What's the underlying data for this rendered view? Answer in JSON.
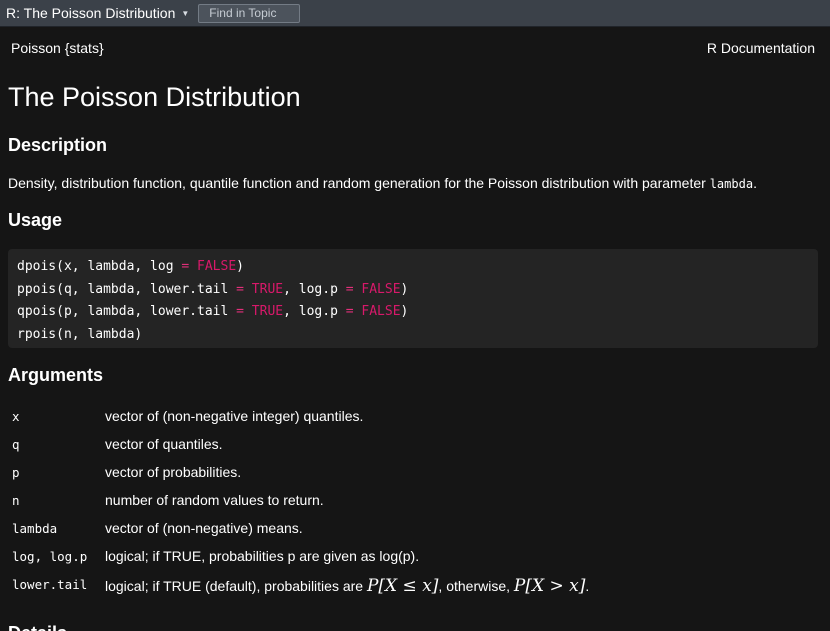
{
  "topbar": {
    "topic_title": "R: The Poisson Distribution",
    "find_placeholder": "Find in Topic"
  },
  "header": {
    "left": "Poisson {stats}",
    "right": "R Documentation"
  },
  "title": "The Poisson Distribution",
  "description": {
    "heading": "Description",
    "text": "Density, distribution function, quantile function and random generation for the Poisson distribution with parameter ",
    "code": "lambda",
    "end": "."
  },
  "usage": {
    "heading": "Usage",
    "lines": {
      "l1a": "dpois(x, lambda, log ",
      "l1b": " FALSE",
      "l1c": ")",
      "l2a": "ppois(q, lambda, lower.tail ",
      "l2b": " TRUE",
      "l2c": ", log.p ",
      "l2d": " FALSE",
      "l2e": ")",
      "l3a": "qpois(p, lambda, lower.tail ",
      "l3b": " TRUE",
      "l3c": ", log.p ",
      "l3d": " FALSE",
      "l3e": ")",
      "l4": "rpois(n, lambda)",
      "eq": "="
    }
  },
  "arguments": {
    "heading": "Arguments",
    "items": [
      {
        "name": "x",
        "desc": "vector of (non-negative integer) quantiles."
      },
      {
        "name": "q",
        "desc": "vector of quantiles."
      },
      {
        "name": "p",
        "desc": "vector of probabilities."
      },
      {
        "name": "n",
        "desc": "number of random values to return."
      },
      {
        "name": "lambda",
        "desc": "vector of (non-negative) means."
      },
      {
        "name": "log, log.p",
        "desc": "logical; if TRUE, probabilities p are given as log(p)."
      },
      {
        "name": "lower.tail",
        "desc_a": "logical; if TRUE (default), probabilities are ",
        "math1": "P[X ≤ x]",
        "desc_b": ", otherwise, ",
        "math2": "P[X > x]",
        "desc_c": "."
      }
    ]
  },
  "details": {
    "heading": "Details"
  },
  "colors": {
    "background": "#151515",
    "topbar": "#3b4149",
    "code_bg": "#242424",
    "keyword": "#d8196a"
  }
}
